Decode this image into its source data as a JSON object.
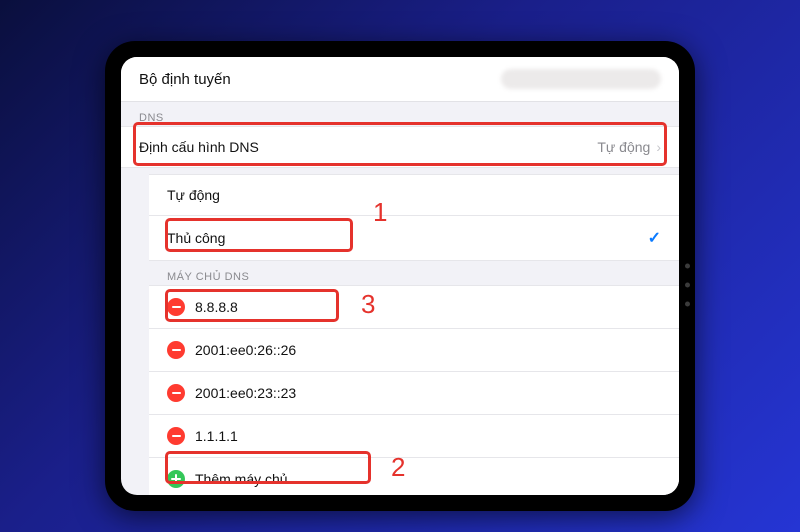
{
  "header": {
    "router_label": "Bộ định tuyến"
  },
  "dns_section": {
    "label": "DNS",
    "config_label": "Định cấu hình DNS",
    "config_value": "Tự động"
  },
  "mode": {
    "auto_label": "Tự động",
    "manual_label": "Thủ công"
  },
  "servers": {
    "label": "MÁY CHỦ DNS",
    "list": [
      {
        "value": "8.8.8.8"
      },
      {
        "value": "2001:ee0:26::26"
      },
      {
        "value": "2001:ee0:23::23"
      },
      {
        "value": "1.1.1.1"
      }
    ],
    "add_label": "Thêm máy chủ"
  },
  "annotations": {
    "n1": "1",
    "n2": "2",
    "n3": "3"
  }
}
